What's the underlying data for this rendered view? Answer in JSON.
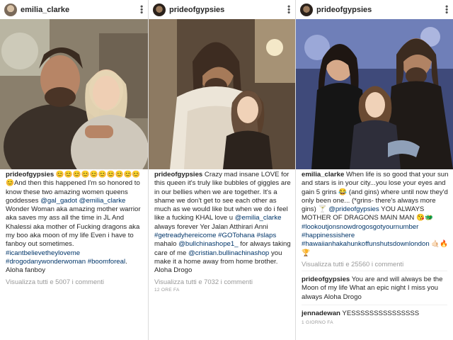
{
  "colors": {
    "link": "#003569",
    "muted": "#999999",
    "text": "#262626"
  },
  "posts": [
    {
      "username": "emilia_clarke",
      "more_icon": "more-vertical-icon",
      "caption_user": "prideofgypsies",
      "caption_text_1": " 😊😊😊😊😊😊😊😊😊😊😊And then this happened  I'm so honored to know these two amazing women queens goddesses ",
      "mention_1": "@gal_gadot",
      "mention_2": "@emilia_clarke",
      "caption_text_2": "  Wonder Woman aka amazing mother warrior aka saves my ass all the time in JL And Khalessi aka mother of Fucking dragons  aka my boo aka moon of my life  Even i have to fanboy out sometimes. ",
      "hashtag_1": "#icantbelievetheyloveme",
      "hashtag_2": "#drogodanywonderwoman",
      "hashtag_3": "#boomforeal",
      "caption_text_3": ". Aloha fanboy",
      "views": "Visualizza tutti e 5007 i commenti"
    },
    {
      "username": "prideofgypsies",
      "more_icon": "more-vertical-icon",
      "caption_user": "prideofgypsies",
      "caption_text_1": " Crazy mad insane LOVE  for this queen  it's truly like bubbles of giggles are in our bellies when we are together.  It's a shame we don't get to see each other as much as we would like but when we do i feel like a fucking KHAL  love u ",
      "mention_1": "@emilia_clarke",
      "caption_text_2": " always forever Yer Jalan Atthirari Anni ",
      "hashtag_1": "#getreadyhereicome",
      "hashtag_2": "#GOTohana",
      "hashtag_3": "#slaps",
      "caption_text_3": " mahalo ",
      "mention_2": "@bullchinashope1_",
      "caption_text_4": " for always taking care of me ",
      "mention_3": "@cristian.bullinachinashop",
      "caption_text_5": " you make it a home away from home brother.  Aloha Drogo",
      "views": "Visualizza tutti e 7032 i commenti",
      "ago": "12 ORE FA"
    },
    {
      "username": "prideofgypsies",
      "more_icon": "more-vertical-icon",
      "caption_user": "emilia_clarke",
      "caption_text_1": " When life is so good that your sun and stars is in your city...you lose your eyes and gain 5 grins 😂 (and gins) where until now they'd only been one... (*grins- there's always more gins) 🍸 ",
      "mention_1": "@prideofgypsies",
      "caption_text_2": " YOU ALWAYS MOTHER OF DRAGONS MAIN MAN 😘🐲 ",
      "hashtag_1": "#lookoutjonsnowdrogosgotyournumber",
      "hashtag_2": "#happinessishere",
      "hashtag_3": "#hawaiianhakahunkoffunshutsdownlondon",
      "caption_text_3": " 🤙🏻🔥🏆",
      "views": "Visualizza tutti e 25560 i commenti",
      "comment_1_user": "prideofgypsies",
      "comment_1_text": " You are and will always be the Moon of my life  What an epic night  I miss you always Aloha Drogo",
      "comment_2_user": "jennadewan",
      "comment_2_text": " YESSSSSSSSSSSSSSS",
      "ago": "1 GIORNO FA"
    }
  ]
}
